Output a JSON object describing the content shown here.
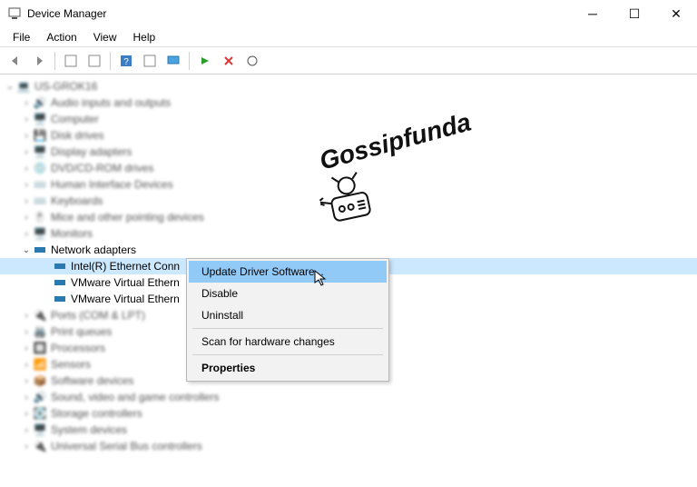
{
  "window": {
    "title": "Device Manager"
  },
  "menu": {
    "file": "File",
    "action": "Action",
    "view": "View",
    "help": "Help"
  },
  "tree": {
    "root": "US-GROK16",
    "cat": {
      "audio": "Audio inputs and outputs",
      "computer": "Computer",
      "disk": "Disk drives",
      "display": "Display adapters",
      "dvd": "DVD/CD-ROM drives",
      "hid": "Human Interface Devices",
      "keyboards": "Keyboards",
      "mice": "Mice and other pointing devices",
      "monitors": "Monitors",
      "network": "Network adapters",
      "ports": "Ports (COM & LPT)",
      "printq": "Print queues",
      "processors": "Processors",
      "sensors": "Sensors",
      "software": "Software devices",
      "sound": "Sound, video and game controllers",
      "storage": "Storage controllers",
      "system": "System devices",
      "usb": "Universal Serial Bus controllers"
    },
    "net": {
      "intel": "Intel(R) Ethernet Conn",
      "vm1": "VMware Virtual Ethern",
      "vm2": "VMware Virtual Ethern"
    }
  },
  "ctx": {
    "update": "Update Driver Software...",
    "disable": "Disable",
    "uninstall": "Uninstall",
    "scan": "Scan for hardware changes",
    "props": "Properties"
  },
  "watermark": "Gossipfunda"
}
